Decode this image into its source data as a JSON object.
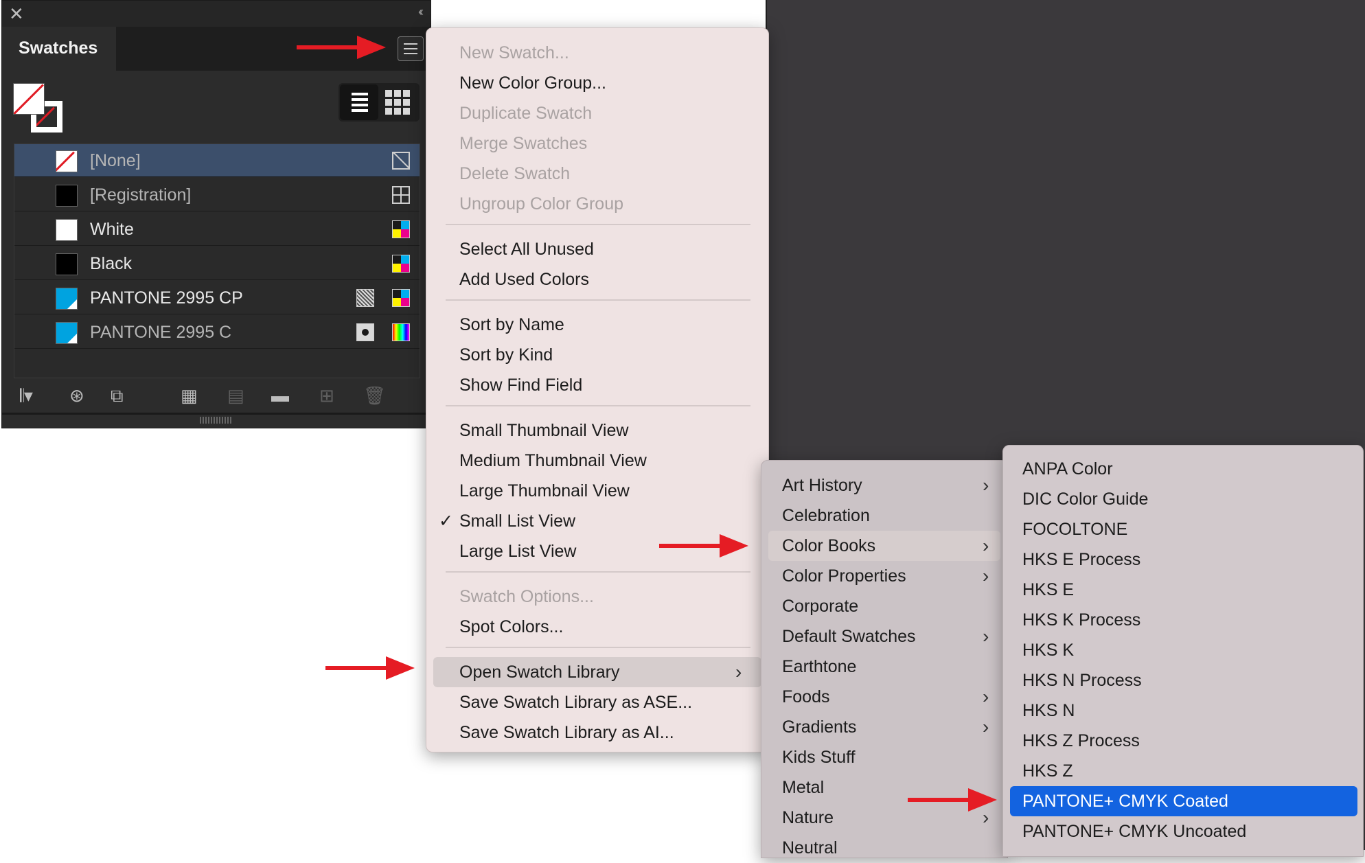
{
  "panel": {
    "tab_title": "Swatches",
    "close_glyph": "✕",
    "collapse_glyph": "‹‹",
    "swatches": [
      {
        "name": "[None]",
        "chip": "none",
        "selected": true,
        "dim": true,
        "icons": [
          "none-swatch-icon"
        ]
      },
      {
        "name": "[Registration]",
        "chip": "#000000",
        "selected": false,
        "dim": true,
        "icons": [
          "registration-icon"
        ]
      },
      {
        "name": "White",
        "chip": "#ffffff",
        "selected": false,
        "dim": false,
        "icons": [
          "cmyk-process-icon"
        ]
      },
      {
        "name": "Black",
        "chip": "#000000",
        "selected": false,
        "dim": false,
        "icons": [
          "cmyk-process-icon"
        ]
      },
      {
        "name": "PANTONE 2995 CP",
        "chip": "#00a3e0",
        "selected": false,
        "dim": false,
        "icons": [
          "pattern-icon",
          "cmyk-process-icon"
        ]
      },
      {
        "name": "PANTONE 2995 C",
        "chip": "#00a3e0",
        "selected": false,
        "dim": true,
        "icons": [
          "spot-color-icon",
          "rgb-icon"
        ]
      }
    ],
    "toolbar_icons": [
      "swatch-libraries-icon",
      "show-kinds-icon",
      "swatch-options-icon",
      "new-color-group-icon",
      "group-options-icon",
      "new-folder-icon",
      "new-swatch-icon",
      "delete-swatch-icon"
    ]
  },
  "panel_menu": {
    "items": [
      {
        "label": "New Swatch...",
        "disabled": true
      },
      {
        "label": "New Color Group...",
        "disabled": false
      },
      {
        "label": "Duplicate Swatch",
        "disabled": true
      },
      {
        "label": "Merge Swatches",
        "disabled": true
      },
      {
        "label": "Delete Swatch",
        "disabled": true
      },
      {
        "label": "Ungroup Color Group",
        "disabled": true
      },
      {
        "label": "Select All Unused",
        "disabled": false
      },
      {
        "label": "Add Used Colors",
        "disabled": false
      },
      {
        "label": "Sort by Name",
        "disabled": false
      },
      {
        "label": "Sort by Kind",
        "disabled": false
      },
      {
        "label": "Show Find Field",
        "disabled": false
      },
      {
        "label": "Small Thumbnail View",
        "disabled": false
      },
      {
        "label": "Medium Thumbnail View",
        "disabled": false
      },
      {
        "label": "Large Thumbnail View",
        "disabled": false
      },
      {
        "label": "Small List View",
        "disabled": false,
        "checked": true
      },
      {
        "label": "Large List View",
        "disabled": false
      },
      {
        "label": "Swatch Options...",
        "disabled": true
      },
      {
        "label": "Spot Colors...",
        "disabled": false
      },
      {
        "label": "Open Swatch Library",
        "disabled": false,
        "submenu": true,
        "highlighted": true
      },
      {
        "label": "Save Swatch Library as ASE...",
        "disabled": false
      },
      {
        "label": "Save Swatch Library as AI...",
        "disabled": false
      }
    ],
    "check_glyph": "✓",
    "submenu_glyph": "›"
  },
  "library_menu": {
    "items": [
      {
        "label": "Art History",
        "submenu": true
      },
      {
        "label": "Celebration",
        "submenu": false
      },
      {
        "label": "Color Books",
        "submenu": true,
        "highlighted": true
      },
      {
        "label": "Color Properties",
        "submenu": true
      },
      {
        "label": "Corporate",
        "submenu": false
      },
      {
        "label": "Default Swatches",
        "submenu": true
      },
      {
        "label": "Earthtone",
        "submenu": false
      },
      {
        "label": "Foods",
        "submenu": true
      },
      {
        "label": "Gradients",
        "submenu": true
      },
      {
        "label": "Kids Stuff",
        "submenu": false
      },
      {
        "label": "Metal",
        "submenu": false
      },
      {
        "label": "Nature",
        "submenu": true
      },
      {
        "label": "Neutral",
        "submenu": false
      }
    ]
  },
  "colorbooks_menu": {
    "items": [
      {
        "label": "ANPA Color"
      },
      {
        "label": "DIC Color Guide"
      },
      {
        "label": "FOCOLTONE"
      },
      {
        "label": "HKS E Process"
      },
      {
        "label": "HKS E"
      },
      {
        "label": "HKS K Process"
      },
      {
        "label": "HKS K"
      },
      {
        "label": "HKS N Process"
      },
      {
        "label": "HKS N"
      },
      {
        "label": "HKS Z Process"
      },
      {
        "label": "HKS Z"
      },
      {
        "label": "PANTONE+ CMYK Coated",
        "selected": true
      },
      {
        "label": "PANTONE+ CMYK Uncoated"
      }
    ]
  },
  "colors": {
    "arrow": "#e51c24",
    "selection_blue": "#1363e0",
    "panel_bg": "#2c2c2c",
    "menu_bg": "#efe3e3",
    "dark_workspace": "#3b393c"
  }
}
